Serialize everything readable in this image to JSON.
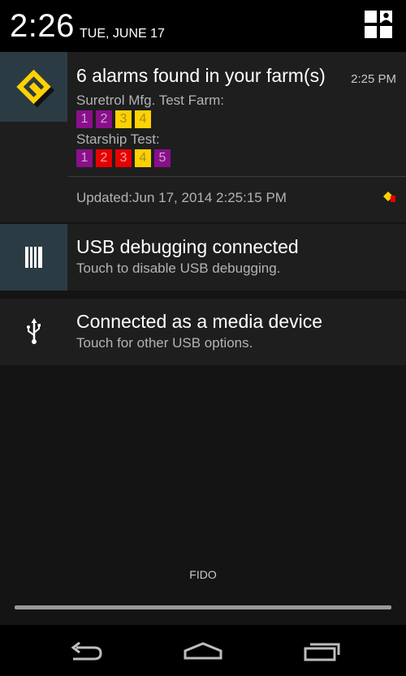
{
  "status": {
    "time": "2:26",
    "date": "TUE, JUNE 17"
  },
  "notifications": {
    "farm": {
      "title": "6 alarms found in your farm(s)",
      "time": "2:25 PM",
      "farms": [
        {
          "name": "Suretrol Mfg. Test Farm:",
          "alarms": [
            {
              "n": "1",
              "color": "purple"
            },
            {
              "n": "2",
              "color": "purple"
            },
            {
              "n": "3",
              "color": "yellow"
            },
            {
              "n": "4",
              "color": "yellow"
            }
          ]
        },
        {
          "name": "Starship Test:",
          "alarms": [
            {
              "n": "1",
              "color": "purple"
            },
            {
              "n": "2",
              "color": "red"
            },
            {
              "n": "3",
              "color": "red"
            },
            {
              "n": "4",
              "color": "yellow"
            },
            {
              "n": "5",
              "color": "purple"
            }
          ]
        }
      ],
      "updated": "Updated:Jun 17, 2014 2:25:15 PM"
    },
    "usb_debugging": {
      "title": "USB debugging connected",
      "text": "Touch to disable USB debugging."
    },
    "media": {
      "title": "Connected as a media device",
      "text": "Touch for other USB options."
    }
  },
  "footer": {
    "label": "FIDO"
  },
  "icons": {
    "app": "suretrol-logo-icon",
    "usb_debug": "usb-debugging-icon",
    "usb": "usb-icon",
    "settings": "quick-settings-icon",
    "back": "back-icon",
    "home": "home-icon",
    "recents": "recents-icon"
  },
  "colors": {
    "purple": "#8a0f8a",
    "red": "#e60000",
    "yellow": "#ffd200",
    "icon_bg": "#2b3b44"
  }
}
